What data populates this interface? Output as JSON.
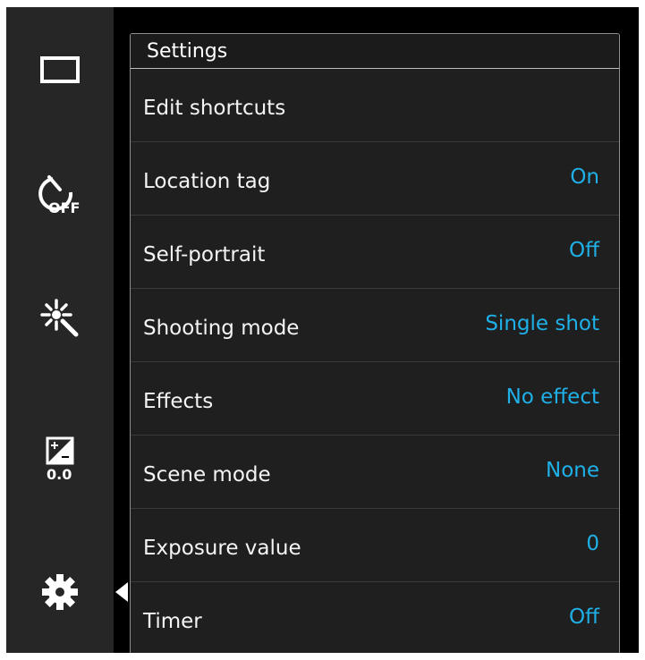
{
  "sidebar": {
    "icons": [
      {
        "name": "aspect-ratio-icon"
      },
      {
        "name": "timer-off-icon",
        "text": "OFF"
      },
      {
        "name": "effects-icon"
      },
      {
        "name": "exposure-icon",
        "text": "0.0"
      },
      {
        "name": "settings-gear-icon"
      }
    ]
  },
  "panel": {
    "title": "Settings",
    "items": [
      {
        "label": "Edit shortcuts",
        "value": ""
      },
      {
        "label": "Location tag",
        "value": "On"
      },
      {
        "label": "Self-portrait",
        "value": "Off"
      },
      {
        "label": "Shooting mode",
        "value": "Single shot"
      },
      {
        "label": "Effects",
        "value": "No effect"
      },
      {
        "label": "Scene mode",
        "value": "None"
      },
      {
        "label": "Exposure value",
        "value": "0"
      },
      {
        "label": "Timer",
        "value": "Off"
      }
    ]
  },
  "colors": {
    "accent": "#1fb0e8",
    "panel_bg": "#1f1f1f",
    "sidebar_bg": "#262626"
  }
}
